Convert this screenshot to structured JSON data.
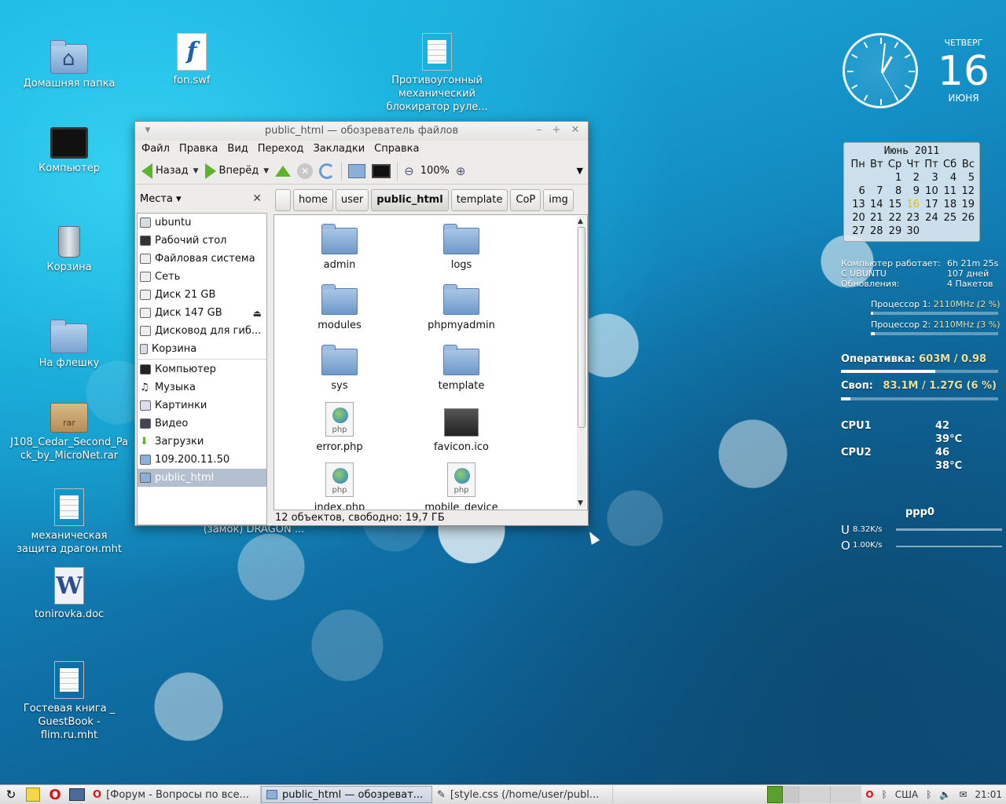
{
  "desktop_icons": [
    {
      "label": "Домашняя папка",
      "icon": "home-folder-icon"
    },
    {
      "label": "fon.swf",
      "icon": "flash-file-icon"
    },
    {
      "label": "Противоугонный механический блокиратор руле...",
      "icon": "text-document-icon"
    },
    {
      "label": "Компьютер",
      "icon": "computer-icon"
    },
    {
      "label": "Корзина",
      "icon": "trash-icon"
    },
    {
      "label": "На флешку",
      "icon": "folder-icon"
    },
    {
      "label": "J108_Cedar_Second_Pack_by_MicroNet.rar",
      "icon": "rar-archive-icon",
      "icon_text": "rar"
    },
    {
      "label": "механическая защита драгон.mht",
      "icon": "text-document-icon"
    },
    {
      "label": "tonirovka.doc",
      "icon": "word-document-icon",
      "icon_text": "W"
    },
    {
      "label": "Гостевая книга _ GuestBook - flim.ru.mht",
      "icon": "text-document-icon"
    },
    {
      "label": "(замок) DRAGON ...",
      "icon": "none"
    }
  ],
  "clock": {
    "time": "21:01",
    "weekday": "ЧЕТВЕРГ",
    "day": "16",
    "month": "ИЮНЯ"
  },
  "calendar": {
    "title": "Июнь 2011",
    "weekdays": [
      "Пн",
      "Вт",
      "Ср",
      "Чт",
      "Пт",
      "Сб",
      "Вс"
    ],
    "weeks": [
      [
        "",
        "",
        "1",
        "2",
        "3",
        "4",
        "5"
      ],
      [
        "6",
        "7",
        "8",
        "9",
        "10",
        "11",
        "12"
      ],
      [
        "13",
        "14",
        "15",
        "16",
        "17",
        "18",
        "19"
      ],
      [
        "20",
        "21",
        "22",
        "23",
        "24",
        "25",
        "26"
      ],
      [
        "27",
        "28",
        "29",
        "30",
        "",
        "",
        ""
      ]
    ],
    "today": "16"
  },
  "sysmon": {
    "uptime_label": "Компьютер работает:",
    "uptime_value": "6h 21m 25s",
    "since_label": "С UBUNTU",
    "since_value": "107 дней",
    "updates_label": "Обновления:",
    "updates_value": "4  Пакетов",
    "cpu1_label": "Процессор 1:",
    "cpu1_freq": "2110MHz /",
    "cpu1_pct": "(2 %)",
    "cpu1_load": 0.02,
    "cpu2_label": "Процессор 2:",
    "cpu2_freq": "2110MHz /",
    "cpu2_pct": "(3 %)",
    "cpu2_load": 0.03,
    "ram_label": "Оперативка:",
    "ram_value": "603M  / 0.98",
    "ram_fill": 0.6,
    "swap_label": "Своп:",
    "swap_value": "83.1M / 1.27G (6 %)",
    "swap_fill": 0.06,
    "cpu1_name": "CPU1",
    "cpu1_val": "42",
    "cpu1_temp": "39°C",
    "cpu2_name": "CPU2",
    "cpu2_val": "46",
    "cpu2_temp": "38°C",
    "net_iface": "ppp0",
    "up_label": "U",
    "up_speed": "8.32K/s",
    "down_label": "O",
    "down_speed": "1.00K/s"
  },
  "window": {
    "title": "public_html — обозреватель файлов",
    "menu": [
      "Файл",
      "Правка",
      "Вид",
      "Переход",
      "Закладки",
      "Справка"
    ],
    "toolbar": {
      "back": "Назад",
      "forward": "Вперёд",
      "zoom": "100%"
    },
    "sidebar": {
      "header": "Места ▾",
      "places": [
        {
          "label": "ubuntu",
          "icon": "home-icon"
        },
        {
          "label": "Рабочий стол",
          "icon": "desktop-icon"
        },
        {
          "label": "Файловая система",
          "icon": "drive-icon"
        },
        {
          "label": "Сеть",
          "icon": "network-icon"
        },
        {
          "label": "Диск 21 GB",
          "icon": "drive-icon"
        },
        {
          "label": "Диск 147 GB",
          "icon": "drive-icon",
          "eject": true
        },
        {
          "label": "Дисковод для гиб...",
          "icon": "floppy-icon"
        },
        {
          "label": "Корзина",
          "icon": "trash-icon"
        }
      ],
      "bookmarks": [
        {
          "label": "Компьютер",
          "icon": "monitor-icon"
        },
        {
          "label": "Музыка",
          "icon": "music-icon"
        },
        {
          "label": "Картинки",
          "icon": "pictures-icon"
        },
        {
          "label": "Видео",
          "icon": "video-icon"
        },
        {
          "label": "Загрузки",
          "icon": "download-icon"
        },
        {
          "label": "109.200.11.50",
          "icon": "folder-icon"
        },
        {
          "label": "public_html",
          "icon": "folder-icon",
          "selected": true
        }
      ]
    },
    "path": [
      "home",
      "user",
      "public_html",
      "template",
      "CoP",
      "img"
    ],
    "active_path": "public_html",
    "files": [
      {
        "name": "admin",
        "type": "folder"
      },
      {
        "name": "logs",
        "type": "folder"
      },
      {
        "name": "modules",
        "type": "folder"
      },
      {
        "name": "phpmyadmin",
        "type": "folder"
      },
      {
        "name": "sys",
        "type": "folder"
      },
      {
        "name": "template",
        "type": "folder"
      },
      {
        "name": "error.php",
        "type": "php"
      },
      {
        "name": "favicon.ico",
        "type": "ico"
      },
      {
        "name": "index.php",
        "type": "php"
      },
      {
        "name": "mobile_device",
        "type": "php"
      }
    ],
    "php_label": "php",
    "status": "12 объектов, свободно: 19,7 ГБ"
  },
  "taskbar": {
    "tasks": [
      {
        "label": "[Форум - Вопросы по все..."
      },
      {
        "label": "public_html — обозреват...",
        "active": true
      },
      {
        "label": "[style.css (/home/user/publ..."
      }
    ],
    "keyboard": "США",
    "clock": "21:01"
  }
}
